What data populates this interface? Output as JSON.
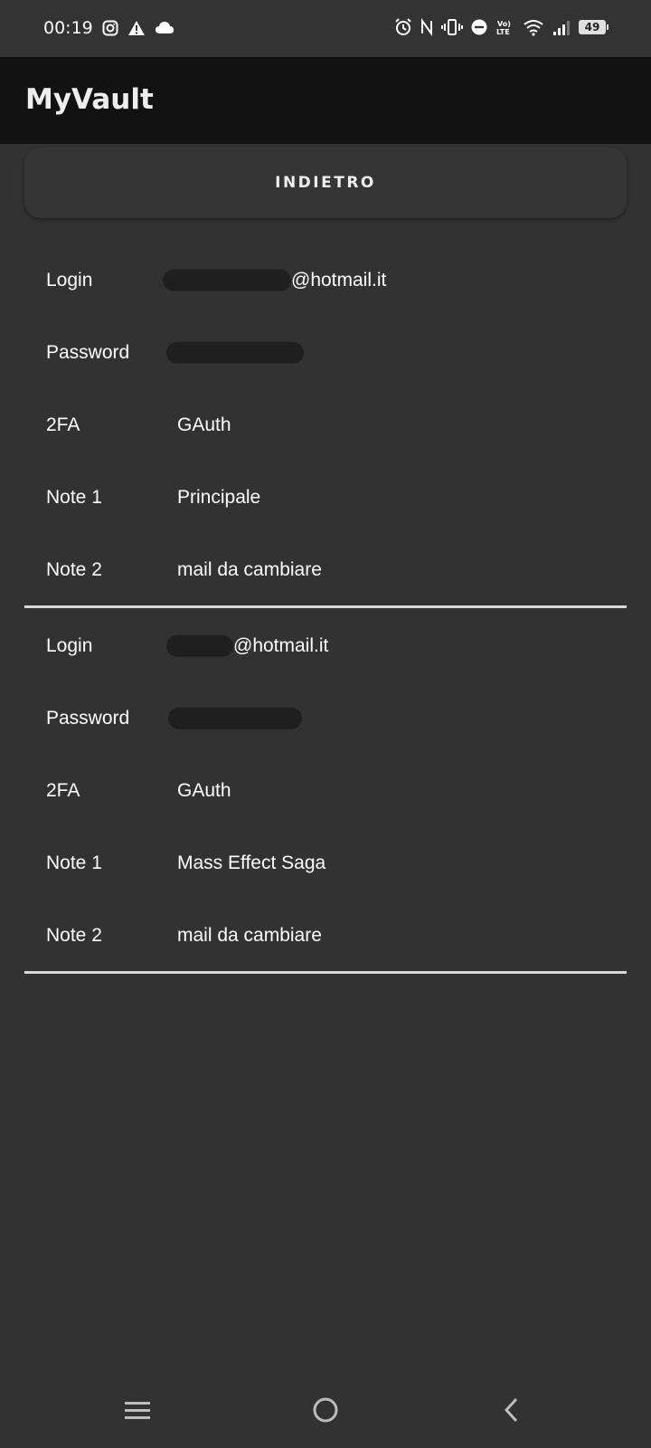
{
  "status_bar": {
    "time": "00:19",
    "battery": "49",
    "left_icons": [
      "instagram-icon",
      "warning-icon",
      "cloud-icon"
    ],
    "right_icons": [
      "alarm-icon",
      "nfc-icon",
      "vibrate-icon",
      "dnd-icon",
      "volte-icon",
      "wifi-icon",
      "signal-icon",
      "battery-icon"
    ]
  },
  "app_bar": {
    "title": "MyVault"
  },
  "back_button": {
    "label": "INDIETRO"
  },
  "entries": [
    {
      "login_label": "Login",
      "login_value": "@hotmail.it",
      "password_label": "Password",
      "twofa_label": "2FA",
      "twofa_value": "GAuth",
      "note1_label": "Note 1",
      "note1_value": "Principale",
      "note2_label": "Note 2",
      "note2_value": "mail da cambiare"
    },
    {
      "login_label": "Login",
      "login_value": "@hotmail.it",
      "password_label": "Password",
      "twofa_label": "2FA",
      "twofa_value": "GAuth",
      "note1_label": "Note 1",
      "note1_value": "Mass Effect Saga",
      "note2_label": "Note 2",
      "note2_value": "mail da cambiare"
    }
  ],
  "nav_bar": {
    "icons": [
      "menu-icon",
      "home-icon",
      "back-icon"
    ]
  },
  "colors": {
    "background": "#323232",
    "app_bar": "#121212",
    "divider": "#d8d8d8",
    "text": "#ffffff"
  }
}
